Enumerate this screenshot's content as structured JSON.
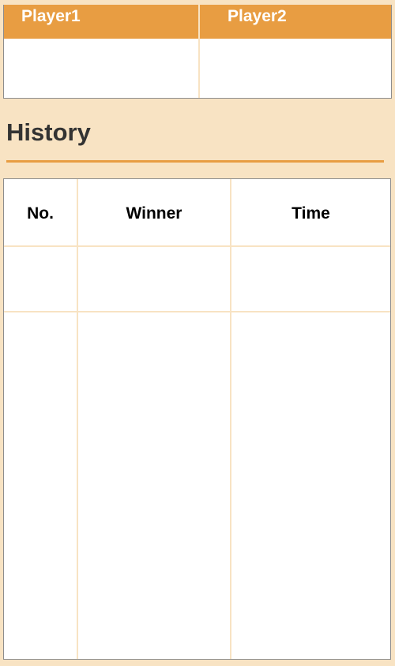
{
  "players": {
    "player1": {
      "label": "Player1",
      "value": ""
    },
    "player2": {
      "label": "Player2",
      "value": ""
    }
  },
  "history": {
    "title": "History",
    "columns": [
      "No.",
      "Winner",
      "Time"
    ],
    "rows": []
  },
  "colors": {
    "background": "#f8e3c3",
    "accent": "#e89d42",
    "heading_text": "#333333"
  }
}
